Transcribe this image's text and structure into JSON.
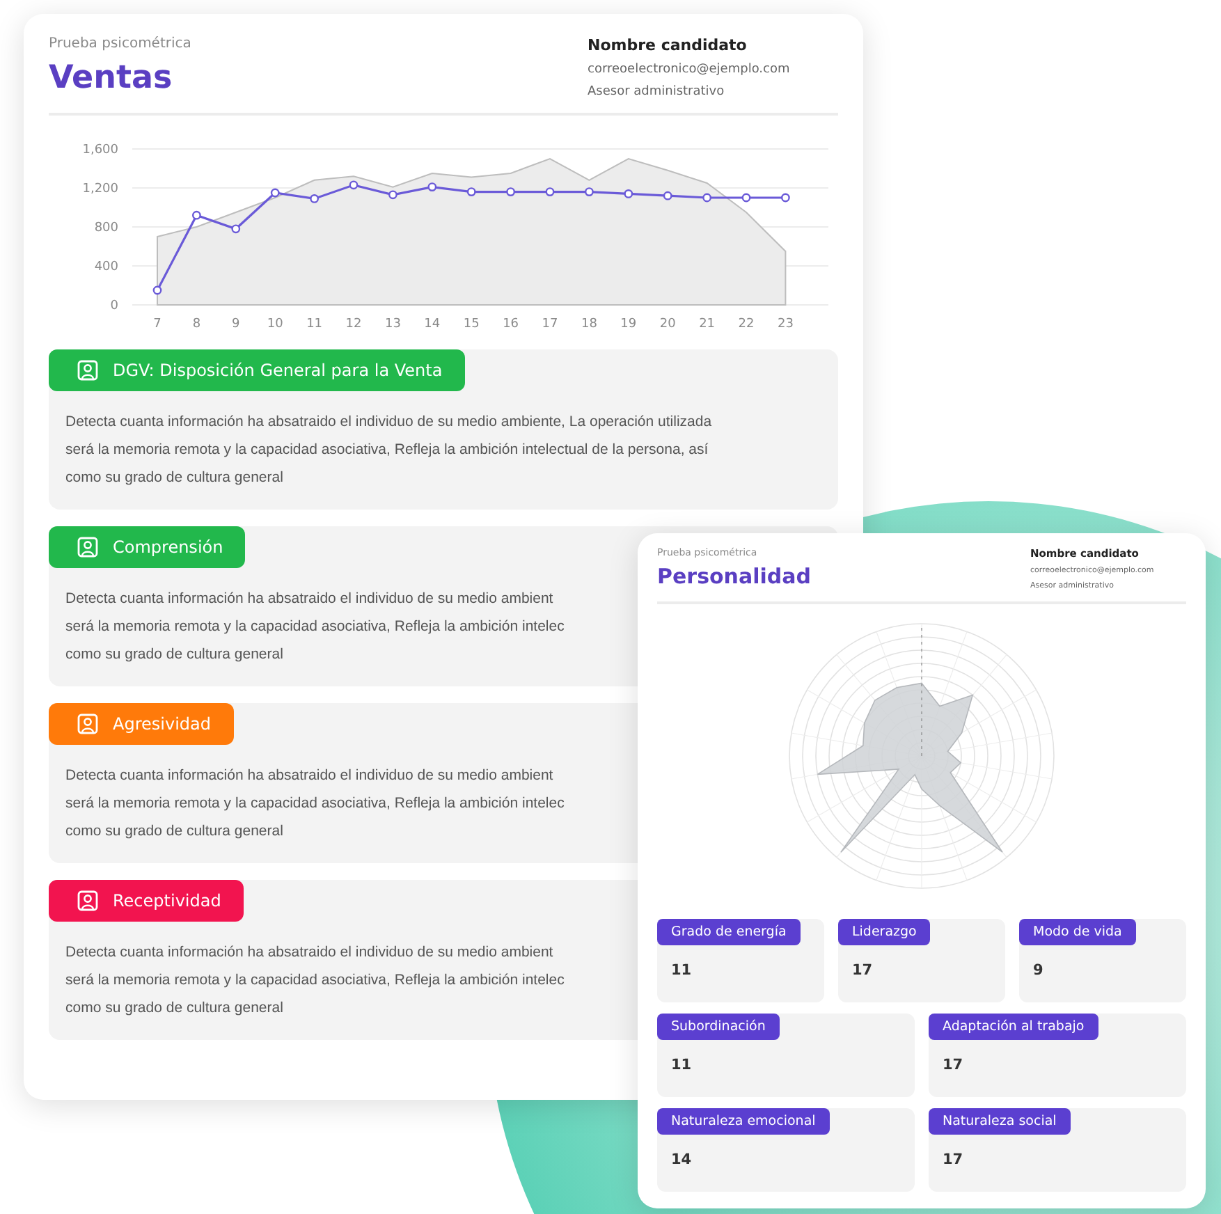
{
  "ventas": {
    "subtitle": "Prueba psicométrica",
    "title": "Ventas",
    "candidate": {
      "name": "Nombre candidato",
      "email": "correoelectronico@ejemplo.com",
      "role": "Asesor administrativo"
    },
    "chart_data": {
      "type": "line",
      "x": [
        "7",
        "8",
        "9",
        "10",
        "11",
        "12",
        "13",
        "14",
        "15",
        "16",
        "17",
        "18",
        "19",
        "20",
        "21",
        "22",
        "23"
      ],
      "ylim": [
        0,
        1600
      ],
      "grid": true,
      "yticks": [
        0,
        {
          "value": 400,
          "label": "400"
        },
        {
          "value": 800,
          "label": "800"
        },
        {
          "value": 1200,
          "label": "1,200"
        },
        {
          "value": 1600,
          "label": "1,600"
        }
      ],
      "series": [
        {
          "type": "area",
          "color": "#bdbdbd",
          "values": [
            700,
            800,
            950,
            1100,
            1280,
            1320,
            1210,
            1350,
            1310,
            1350,
            1500,
            1280,
            1500,
            1380,
            1250,
            950,
            550
          ]
        },
        {
          "type": "line",
          "marker": "circle",
          "color": "#6a5ad8",
          "values": [
            150,
            920,
            780,
            1150,
            1090,
            1230,
            1130,
            1210,
            1160,
            1160,
            1160,
            1160,
            1140,
            1120,
            1100,
            1100,
            1100
          ]
        }
      ]
    },
    "sections": [
      {
        "label": "DGV: Disposición General para la Venta",
        "color": "#22b84c",
        "lines": [
          "Detecta cuanta información ha absatraido el individuo de su medio ambiente, La operación utilizada",
          "será la memoria remota y la capacidad asociativa, Refleja la ambición intelectual de la persona, así",
          "como su grado de cultura general"
        ]
      },
      {
        "label": "Comprensión",
        "color": "#22b84c",
        "lines": [
          "Detecta cuanta información ha absatraido el individuo de su medio ambient",
          "será la memoria remota y la capacidad asociativa, Refleja la ambición intelec",
          "como su grado de cultura general"
        ]
      },
      {
        "label": "Agresividad",
        "color": "#ff7a0a",
        "lines": [
          "Detecta cuanta información ha absatraido el individuo de su medio ambient",
          "será la memoria remota y la capacidad asociativa, Refleja la ambición intelec",
          "como su grado de cultura general"
        ]
      },
      {
        "label": "Receptividad",
        "color": "#f2144f",
        "lines": [
          "Detecta cuanta información ha absatraido el individuo de su medio ambient",
          "será la memoria remota y la capacidad asociativa, Refleja la ambición intelec",
          "como su grado de cultura general"
        ]
      }
    ]
  },
  "personalidad": {
    "subtitle": "Prueba psicométrica",
    "title": "Personalidad",
    "candidate": {
      "name": "Nombre candidato",
      "email": "correoelectronico@ejemplo.com",
      "role": "Asesor administrativo"
    },
    "rows": [
      [
        {
          "label": "Grado de energía",
          "value": "11"
        },
        {
          "label": "Liderazgo",
          "value": "17"
        },
        {
          "label": "Modo de vida",
          "value": "9"
        }
      ],
      [
        {
          "label": "Subordinación",
          "value": "11"
        },
        {
          "label": "Adaptación al trabajo",
          "value": "17"
        }
      ],
      [
        {
          "label": "Naturaleza emocional",
          "value": "14"
        },
        {
          "label": "Naturaleza social",
          "value": "17"
        }
      ]
    ]
  }
}
